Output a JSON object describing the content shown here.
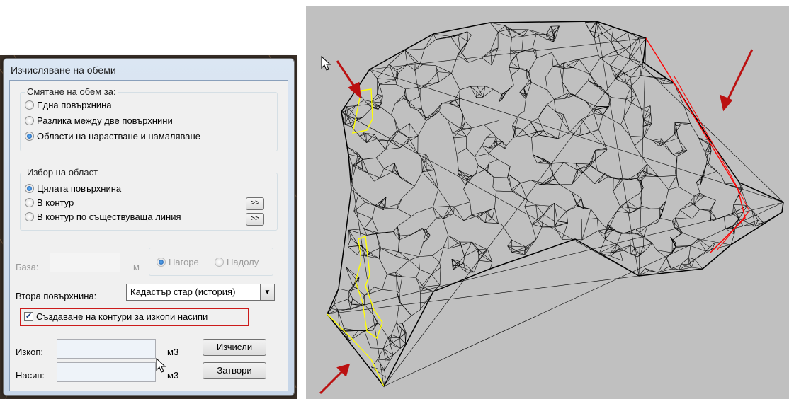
{
  "dialog": {
    "title": "Изчисляване на обеми",
    "volume_group": {
      "legend": "Смятане на обем за:",
      "options": [
        "Една повърхнина",
        "Разлика между две повърхнини",
        "Области на нарастване и намаляване"
      ],
      "selected_index": 2
    },
    "area_group": {
      "legend": "Избор на област",
      "options": [
        "Цялата повърхнина",
        "В контур",
        "В контур по съществуваща линия"
      ],
      "selected_index": 0,
      "browse_label": ">>"
    },
    "base": {
      "label": "База:",
      "value": "",
      "unit": "м",
      "direction_options": [
        "Нагоре",
        "Надолу"
      ],
      "direction_selected_index": 0
    },
    "second_surface": {
      "label": "Втора повърхнина:",
      "value": "Кадастър стар (история)"
    },
    "create_contours": {
      "label": "Създаване на контури за изкопи насипи",
      "checked": true
    },
    "results": {
      "cut_label": "Изкоп:",
      "cut_value": "",
      "cut_unit": "м3",
      "fill_label": "Насип:",
      "fill_value": "",
      "fill_unit": "м3"
    },
    "buttons": {
      "calculate": "Изчисли",
      "close": "Затвори"
    }
  },
  "mesh_view": {
    "background_color": "#c0c0c0",
    "mesh_color": "#000000",
    "cut_contour_color": "#ffff00",
    "fill_contour_color": "#ff0000",
    "annotation_arrow_color": "#bb1111"
  }
}
